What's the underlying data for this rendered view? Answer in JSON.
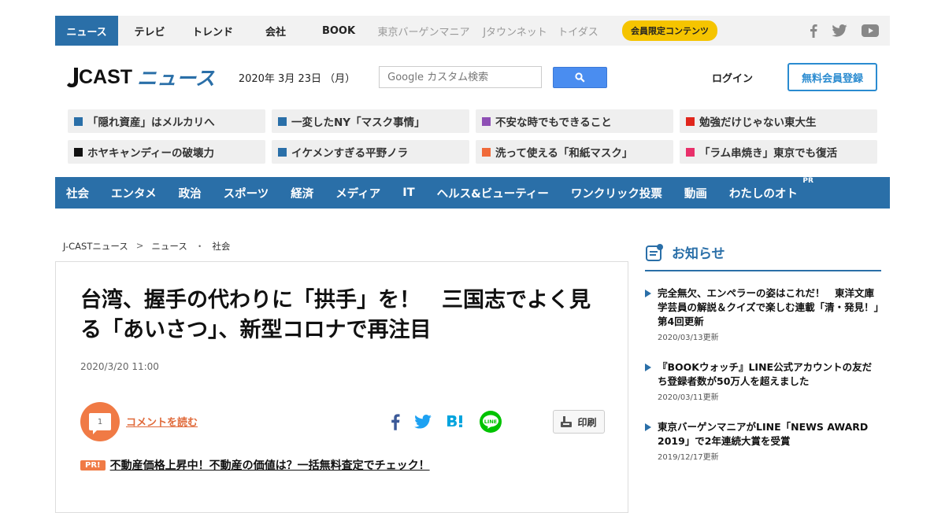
{
  "topnav": {
    "tabs": [
      "ニュース",
      "テレビ",
      "トレンド",
      "会社",
      "BOOK"
    ],
    "subs": [
      "東京バーゲンマニア",
      "Jタウンネット",
      "トイダス"
    ],
    "member_label": "会員限定コンテンツ",
    "social_icons": [
      "facebook-icon",
      "twitter-icon",
      "youtube-icon"
    ]
  },
  "header": {
    "logo_main": "CAST",
    "logo_news": "ニュース",
    "date": "2020年 3月 23日 （月）",
    "search_placeholder": "Google カスタム検索",
    "login": "ログイン",
    "register": "無料会員登録"
  },
  "trends": [
    {
      "label": "「隠れ資産」はメルカリへ",
      "color": "#2a6fa8"
    },
    {
      "label": "一変したNY「マスク事情」",
      "color": "#2a6fa8"
    },
    {
      "label": "不安な時でもできること",
      "color": "#8e4fb5"
    },
    {
      "label": "勉強だけじゃない東大生",
      "color": "#e0261c"
    },
    {
      "label": "ホヤキャンディーの破壊力",
      "color": "#111111"
    },
    {
      "label": "イケメンすぎる平野ノラ",
      "color": "#2a6fa8"
    },
    {
      "label": "洗って使える「和紙マスク」",
      "color": "#f06a3a"
    },
    {
      "label": "「ラム串焼き」東京でも復活",
      "color": "#e8306a"
    }
  ],
  "categories": [
    "社会",
    "エンタメ",
    "政治",
    "スポーツ",
    "経済",
    "メディア",
    "IT",
    "ヘルス&ビューティー",
    "ワンクリック投票",
    "動画",
    "わたしのオト"
  ],
  "category_pr": "PR",
  "breadcrumb": [
    "J-CASTニュース",
    ">",
    "ニュース",
    "・",
    "社会"
  ],
  "article": {
    "title": "台湾、握手の代わりに「拱手」を！　三国志でよく見る「あいさつ」、新型コロナで再注目",
    "date": "2020/3/20 11:00",
    "comment_count": "1",
    "comment_link": "コメントを読む",
    "print": "印刷",
    "pr_badge": "PR!",
    "pr_link": "不動産価格上昇中！不動産の価値は？一括無料査定でチェック！"
  },
  "sidebar": {
    "heading": "お知らせ",
    "notices": [
      {
        "text": "完全無欠、エンペラーの姿はこれだ！　東洋文庫学芸員の解説＆クイズで楽しむ連載「清・発見！」第4回更新",
        "date": "2020/03/13更新"
      },
      {
        "text": "『BOOKウォッチ』LINE公式アカウントの友だち登録者数が50万人を超えました",
        "date": "2020/03/11更新"
      },
      {
        "text": "東京バーゲンマニアがLINE「NEWS AWARD 2019」で2年連続大賞を受賞",
        "date": "2019/12/17更新"
      }
    ]
  }
}
